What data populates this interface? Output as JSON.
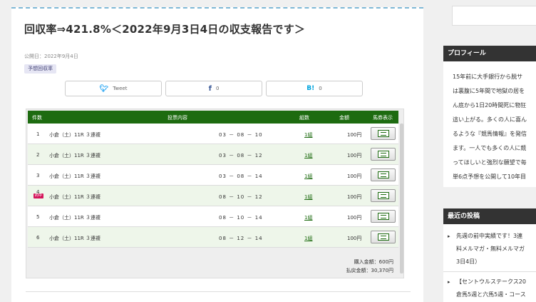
{
  "article": {
    "title": "回収率⇒421.8%＜2022年9月3日4日の収支報告です＞",
    "published": "公開日：2022年9月4日",
    "category": "予想回収率"
  },
  "share": {
    "tweet": "Tweet",
    "facebook_count": "0",
    "hatena_label": "B!",
    "hatena_count": "0"
  },
  "bet_table": {
    "headers": {
      "no": "件数",
      "content": "投票内容",
      "count": "組数",
      "amount": "金額",
      "ticket": "馬券表示"
    },
    "rows": [
      {
        "no": "1",
        "race": "小倉（土）11R ３連複",
        "combo": "03 － 08 － 10",
        "count": "1組",
        "amount": "100円",
        "hit": ""
      },
      {
        "no": "2",
        "race": "小倉（土）11R ３連複",
        "combo": "03 － 08 － 12",
        "count": "1組",
        "amount": "100円",
        "hit": ""
      },
      {
        "no": "3",
        "race": "小倉（土）11R ３連複",
        "combo": "03 － 08 － 14",
        "count": "1組",
        "amount": "100円",
        "hit": ""
      },
      {
        "no": "4",
        "race": "小倉（土）11R ３連複",
        "combo": "08 － 10 － 12",
        "count": "1組",
        "amount": "100円",
        "hit": "的中"
      },
      {
        "no": "5",
        "race": "小倉（土）11R ３連複",
        "combo": "08 － 10 － 14",
        "count": "1組",
        "amount": "100円",
        "hit": ""
      },
      {
        "no": "6",
        "race": "小倉（土）11R ３連複",
        "combo": "08 － 12 － 14",
        "count": "1組",
        "amount": "100円",
        "hit": ""
      }
    ],
    "purchase_total": "購入金額：600円",
    "payout_total": "払戻金額：30,370円"
  },
  "sidebar": {
    "profile_title": "プロフィール",
    "profile_text": "15年前に大手銀行から脱サ\nは裏腹に5年間で地獄の居を\nん底から1日20時間死に物狂\n這い上がる。多くの人に喜ん\nるような『競馬情報』を発信\nます。一人でも多くの人に競\nってほしいと強烈な願望で毎\n単6点予想を公開して10年目",
    "recent_title": "最近の投稿",
    "recent_posts": [
      "先週の前中実績です！3連\n料メルマガ・無料メルマガ\n3日4日）",
      "【セントウルステークス20\n倉馬5週と六馬5週・コース"
    ]
  }
}
